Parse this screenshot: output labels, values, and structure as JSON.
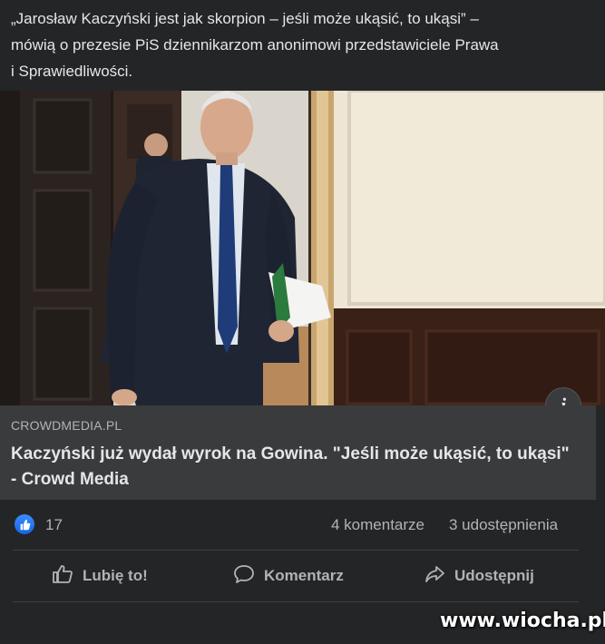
{
  "post": {
    "text": "„Jarosław Kaczyński jest jak skorpion – jeśli może ukąsić, to ukąsi” –\nmówią o prezesie PiS dziennikarzom anonimowi przedstawiciele Prawa\ni Sprawiedliwości."
  },
  "link_preview": {
    "domain": "CROWDMEDIA.PL",
    "title": "Kaczyński już wydał wyrok na Gowina. \"Jeśli może ukąsić, to ukąsi\" - Crowd Media",
    "info_icon": "i"
  },
  "stats": {
    "like_count": "17",
    "comments": "4 komentarze",
    "shares": "3 udostępnienia"
  },
  "actions": {
    "like_label": "Lubię to!",
    "comment_label": "Komentarz",
    "share_label": "Udostępnij"
  },
  "watermark": "www.wiocha.pl",
  "colors": {
    "background": "#242526",
    "link_box": "#3a3b3c",
    "like_blue": "#1877f2",
    "text": "#e4e6eb",
    "muted": "#b0b3b8"
  }
}
